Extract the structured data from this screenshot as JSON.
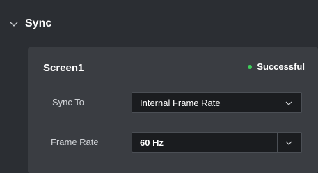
{
  "sync_section": {
    "title": "Sync",
    "chevron_icon": "chevron-down-icon"
  },
  "screen": {
    "name": "Screen1",
    "status_text": "Successful",
    "status_color": "#3ecf5a"
  },
  "sync_to": {
    "label": "Sync To",
    "value": "Internal Frame Rate"
  },
  "frame_rate": {
    "label": "Frame Rate",
    "value": "60 Hz"
  }
}
